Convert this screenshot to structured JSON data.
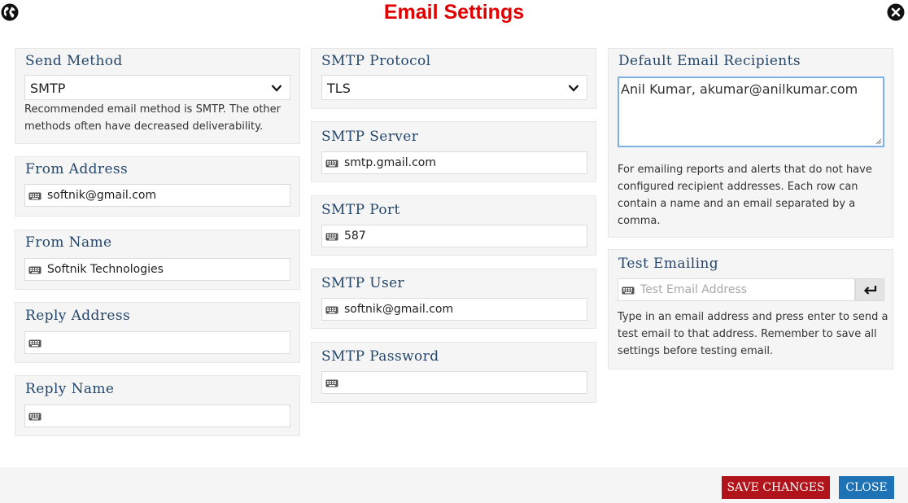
{
  "window": {
    "title": "Email Settings"
  },
  "send_method": {
    "title": "Send Method",
    "selected": "SMTP",
    "helper": "Recommended email method is SMTP. The other methods often have decreased deliverability."
  },
  "from_address": {
    "title": "From Address",
    "value": "softnik@gmail.com"
  },
  "from_name": {
    "title": "From Name",
    "value": "Softnik Technologies"
  },
  "reply_address": {
    "title": "Reply Address",
    "value": ""
  },
  "reply_name": {
    "title": "Reply Name",
    "value": ""
  },
  "smtp_protocol": {
    "title": "SMTP Protocol",
    "selected": "TLS"
  },
  "smtp_server": {
    "title": "SMTP Server",
    "value": "smtp.gmail.com"
  },
  "smtp_port": {
    "title": "SMTP Port",
    "value": "587"
  },
  "smtp_user": {
    "title": "SMTP User",
    "value": "softnik@gmail.com"
  },
  "smtp_password": {
    "title": "SMTP Password",
    "value": ""
  },
  "default_recipients": {
    "title": "Default Email Recipients",
    "value": "Anil Kumar, akumar@anilkumar.com",
    "helper": "For emailing reports and alerts that do not have configured recipient addresses. Each row can contain a name and an email separated by a comma."
  },
  "test_emailing": {
    "title": "Test Emailing",
    "placeholder": "Test Email Address",
    "helper": "Type in an email address and press enter to send a test email to that address. Remember to save all settings before testing email."
  },
  "footer": {
    "save_label": "Save Changes",
    "close_label": "Close"
  },
  "icons": {
    "top_left": "globe-icon",
    "top_right": "close-circle-icon",
    "input": "keyboard-icon",
    "select": "chevron-down-icon",
    "enter": "enter-return-icon"
  },
  "colors": {
    "title": "#e00000",
    "panel_heading": "#24476b",
    "save_button": "#b0141a",
    "close_button": "#1e73b7",
    "textarea_focus": "#7ab1e6"
  }
}
